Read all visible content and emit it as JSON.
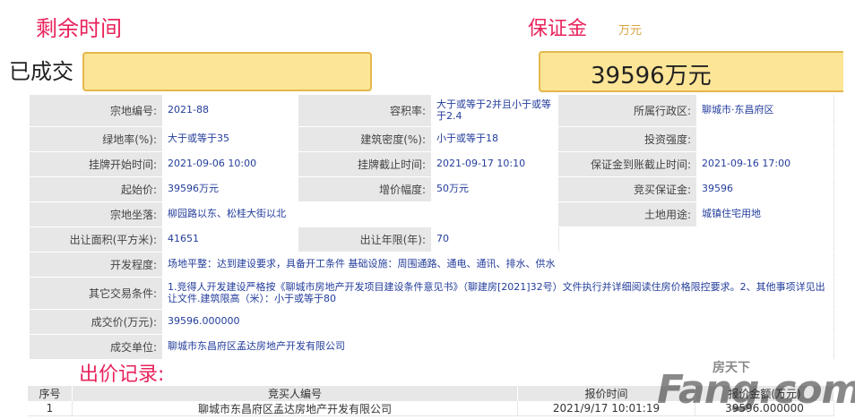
{
  "header": {
    "remaining_time_label": "剩余时间",
    "deposit_label": "保证金",
    "deposit_unit": "万元",
    "status": "已成交",
    "deposit_value": "39596万元"
  },
  "info": {
    "parcel_no_label": "宗地编号:",
    "parcel_no": "2021-88",
    "plot_ratio_label": "容积率:",
    "plot_ratio": "大于或等于2并且小于或等于2.4",
    "district_label": "所属行政区:",
    "district": "聊城市·东昌府区",
    "green_rate_label": "绿地率(%):",
    "green_rate": "大于或等于35",
    "building_density_label": "建筑密度(%):",
    "building_density": "小于或等于18",
    "invest_intensity_label": "投资强度:",
    "invest_intensity": "",
    "listing_start_label": "挂牌开始时间:",
    "listing_start": "2021-09-06 10:00",
    "listing_end_label": "挂牌截止时间:",
    "listing_end": "2021-09-17 10:10",
    "deposit_deadline_label": "保证金到账截止时间:",
    "deposit_deadline": "2021-09-16 17:00",
    "start_price_label": "起始价:",
    "start_price": "39596万元",
    "increment_label": "增价幅度:",
    "increment": "50万元",
    "bid_deposit_label": "竞买保证金:",
    "bid_deposit": "39596",
    "location_label": "宗地坐落:",
    "location": "柳园路以东、松桂大街以北",
    "land_use_label": "土地用途:",
    "land_use": "城镇住宅用地",
    "area_label": "出让面积(平方米):",
    "area": "41651",
    "term_label": "出让年限(年):",
    "term": "70",
    "dev_level_label": "开发程度:",
    "dev_level": "场地平整：达到建设要求，具备开工条件 基础设施：周围通路、通电、通讯、排水、供水",
    "other_conditions_label": "其它交易条件:",
    "other_conditions": "1.竞得人开发建设严格按《聊城市房地产开发项目建设条件意见书》（聊建房[2021]32号）文件执行并详细阅读住房价格限控要求。2、其他事项详见出让文件.建筑限高（米）：小于或等于80",
    "deal_price_label": "成交价(万元):",
    "deal_price": "39596.000000",
    "deal_unit_label": "成交单位:",
    "deal_unit": "聊城市东昌府区孟达房地产开发有限公司"
  },
  "bids": {
    "title": "出价记录:",
    "headers": [
      "序号",
      "竞买人编号",
      "报价时间",
      "报价金额(万元)"
    ],
    "rows": [
      [
        "1",
        "聊城市东昌府区孟达房地产开发有限公司",
        "2021/9/17 10:01:19",
        "39596.000000"
      ]
    ]
  },
  "watermark": {
    "main": "Fang.com",
    "cn": "房天下"
  },
  "colors": {
    "accent_red": "#e8245c",
    "bar_fill": "#fce597",
    "bar_border": "#e4b74c",
    "label_bg": "#e7e7e7",
    "value_text": "#233d9b"
  }
}
